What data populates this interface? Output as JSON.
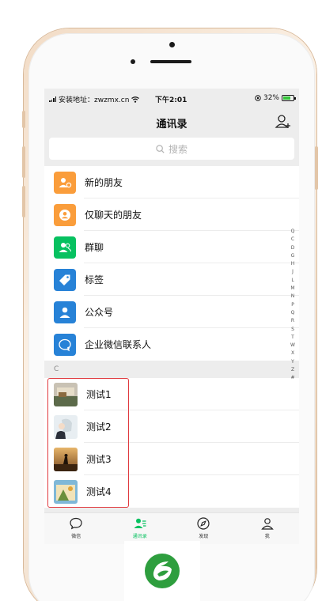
{
  "status_bar": {
    "carrier": "安装地址：zwzmx.cn",
    "time": "下午2:01",
    "battery": "32%"
  },
  "nav": {
    "title": "通讯录"
  },
  "search": {
    "placeholder": "搜索"
  },
  "menu": [
    {
      "label": "新的朋友",
      "icon": "add-friend-icon",
      "color": "#fa9d3b"
    },
    {
      "label": "仅聊天的朋友",
      "icon": "chat-only-friend-icon",
      "color": "#fa9d3b"
    },
    {
      "label": "群聊",
      "icon": "group-chat-icon",
      "color": "#07c160"
    },
    {
      "label": "标签",
      "icon": "tag-icon",
      "color": "#2782d7"
    },
    {
      "label": "公众号",
      "icon": "official-account-icon",
      "color": "#2782d7"
    },
    {
      "label": "企业微信联系人",
      "icon": "enterprise-contact-icon",
      "color": "#2782d7"
    }
  ],
  "section_letter": "C",
  "contacts": [
    {
      "name": "测试1"
    },
    {
      "name": "测试2"
    },
    {
      "name": "测试3"
    },
    {
      "name": "测试4"
    }
  ],
  "index_letters": [
    "Q",
    "C",
    "D",
    "G",
    "H",
    "J",
    "L",
    "M",
    "N",
    "P",
    "Q",
    "R",
    "S",
    "T",
    "W",
    "X",
    "Y",
    "Z",
    "#"
  ],
  "tabs": [
    {
      "label": "微信",
      "icon": "chat-bubble-icon",
      "active": false
    },
    {
      "label": "通讯录",
      "icon": "contacts-icon",
      "active": true
    },
    {
      "label": "发现",
      "icon": "compass-icon",
      "active": false
    },
    {
      "label": "我",
      "icon": "person-icon",
      "active": false
    }
  ],
  "colors": {
    "accent": "#07c160",
    "selection": "#e0393e"
  }
}
